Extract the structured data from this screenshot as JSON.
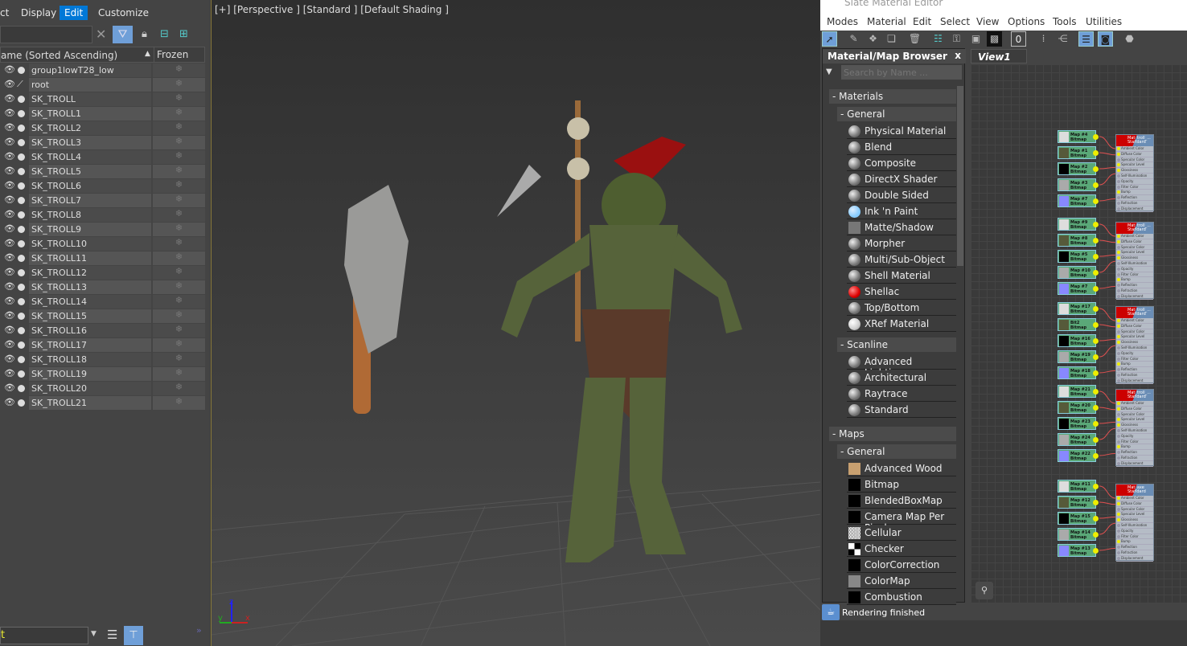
{
  "scene_explorer": {
    "menu": [
      "ct",
      "Display",
      "Edit",
      "Customize"
    ],
    "selected_menu": "Edit",
    "column_name": "ame (Sorted Ascending)",
    "column_frozen": "Frozen",
    "sort_indicator": "▲",
    "rows": [
      "group1lowT28_low",
      "root",
      "SK_TROLL",
      "SK_TROLL1",
      "SK_TROLL2",
      "SK_TROLL3",
      "SK_TROLL4",
      "SK_TROLL5",
      "SK_TROLL6",
      "SK_TROLL7",
      "SK_TROLL8",
      "SK_TROLL9",
      "SK_TROLL10",
      "SK_TROLL11",
      "SK_TROLL12",
      "SK_TROLL13",
      "SK_TROLL14",
      "SK_TROLL15",
      "SK_TROLL16",
      "SK_TROLL17",
      "SK_TROLL18",
      "SK_TROLL19",
      "SK_TROLL20",
      "SK_TROLL21"
    ],
    "layer_field": "t",
    "expand": "»"
  },
  "viewport": {
    "label": "[+] [Perspective ] [Standard ] [Default Shading ]",
    "axes": {
      "x": "x",
      "y": "y",
      "z": "z"
    }
  },
  "slate": {
    "title": "Slate Material Editor",
    "menu": [
      "Modes",
      "Material",
      "Edit",
      "Select",
      "View",
      "Options",
      "Tools",
      "Utilities"
    ],
    "browser_title": "Material/Map Browser",
    "close": "x",
    "search_placeholder": "Search by Name ...",
    "view_tab": "View1",
    "status": "Rendering finished",
    "sections": [
      {
        "title": "- Materials",
        "groups": [
          {
            "title": "- General",
            "items": [
              {
                "label": "Physical Material",
                "swatch": "sphere-gray"
              },
              {
                "label": "Blend",
                "swatch": "sphere-gray"
              },
              {
                "label": "Composite",
                "swatch": "sphere-gray"
              },
              {
                "label": "DirectX Shader",
                "swatch": "sphere-gray"
              },
              {
                "label": "Double Sided",
                "swatch": "sphere-gray"
              },
              {
                "label": "Ink 'n Paint",
                "swatch": "sphere-blue"
              },
              {
                "label": "Matte/Shadow",
                "swatch": "square-gray"
              },
              {
                "label": "Morpher",
                "swatch": "sphere-gray"
              },
              {
                "label": "Multi/Sub-Object",
                "swatch": "sphere-gray"
              },
              {
                "label": "Shell Material",
                "swatch": "sphere-gray"
              },
              {
                "label": "Shellac",
                "swatch": "sphere-red"
              },
              {
                "label": "Top/Bottom",
                "swatch": "sphere-gray"
              },
              {
                "label": "XRef Material",
                "swatch": "sphere-white"
              }
            ]
          },
          {
            "title": "- Scanline",
            "items": [
              {
                "label": "Advanced Lighting...",
                "swatch": "sphere-gray"
              },
              {
                "label": "Architectural",
                "swatch": "sphere-gray"
              },
              {
                "label": "Raytrace",
                "swatch": "sphere-gray"
              },
              {
                "label": "Standard",
                "swatch": "sphere-gray"
              }
            ]
          }
        ]
      },
      {
        "title": "- Maps",
        "groups": [
          {
            "title": "- General",
            "items": [
              {
                "label": "Advanced Wood",
                "swatch": "wood"
              },
              {
                "label": "Bitmap",
                "swatch": "black"
              },
              {
                "label": "BlendedBoxMap",
                "swatch": "black"
              },
              {
                "label": "Camera Map Per Pixel",
                "swatch": "black"
              },
              {
                "label": "Cellular",
                "swatch": "noise"
              },
              {
                "label": "Checker",
                "swatch": "checker"
              },
              {
                "label": "ColorCorrection",
                "swatch": "black"
              },
              {
                "label": "ColorMap",
                "swatch": "gray"
              },
              {
                "label": "Combustion",
                "swatch": "black"
              }
            ]
          }
        ]
      }
    ],
    "node_groups": [
      {
        "material": "Mat_troll_...",
        "type": "Standard",
        "maps": [
          [
            "Map #4",
            "Bitmap"
          ],
          [
            "Map #1",
            "Bitmap"
          ],
          [
            "Map #2",
            "Bitmap"
          ],
          [
            "Map #3",
            "Bitmap"
          ],
          [
            "Map #7",
            "Bitmap"
          ]
        ]
      },
      {
        "material": "Mat_troll_...",
        "type": "Standard",
        "maps": [
          [
            "Map #9",
            "Bitmap"
          ],
          [
            "Map #8",
            "Bitmap"
          ],
          [
            "Map #5",
            "Bitmap"
          ],
          [
            "Map #10",
            "Bitmap"
          ],
          [
            "Map #7",
            "Bitmap"
          ]
        ]
      },
      {
        "material": "Mat_troll_...",
        "type": "Standard",
        "maps": [
          [
            "Map #17",
            "Bitmap"
          ],
          [
            "Bit2",
            "Bitmap"
          ],
          [
            "Map #16",
            "Bitmap"
          ],
          [
            "Map #19",
            "Bitmap"
          ],
          [
            "Map #18",
            "Bitmap"
          ]
        ]
      },
      {
        "material": "Mat_troll_...",
        "type": "Standard",
        "maps": [
          [
            "Map #21",
            "Bitmap"
          ],
          [
            "Map #20",
            "Bitmap"
          ],
          [
            "Map #23",
            "Bitmap"
          ],
          [
            "Map #24",
            "Bitmap"
          ],
          [
            "Map #22",
            "Bitmap"
          ]
        ]
      },
      {
        "material": "Mat_axe",
        "type": "Standard",
        "maps": [
          [
            "Map #11",
            "Bitmap"
          ],
          [
            "Map #12",
            "Bitmap"
          ],
          [
            "Map #15",
            "Bitmap"
          ],
          [
            "Map #14",
            "Bitmap"
          ],
          [
            "Map #13",
            "Bitmap"
          ]
        ]
      }
    ],
    "slots": [
      "Ambient Color",
      "Diffuse Color",
      "Specular Color",
      "Specular Level",
      "Glossiness",
      "Self-Illumination",
      "Opacity",
      "Filter Color",
      "Bump",
      "Reflection",
      "Refraction",
      "Displacement"
    ]
  },
  "colors": {
    "accent": "#0078d7",
    "toggle": "#6f9fd8",
    "map_node": "#5aa878",
    "socket": "#eeee00",
    "wire": "#e05050"
  }
}
